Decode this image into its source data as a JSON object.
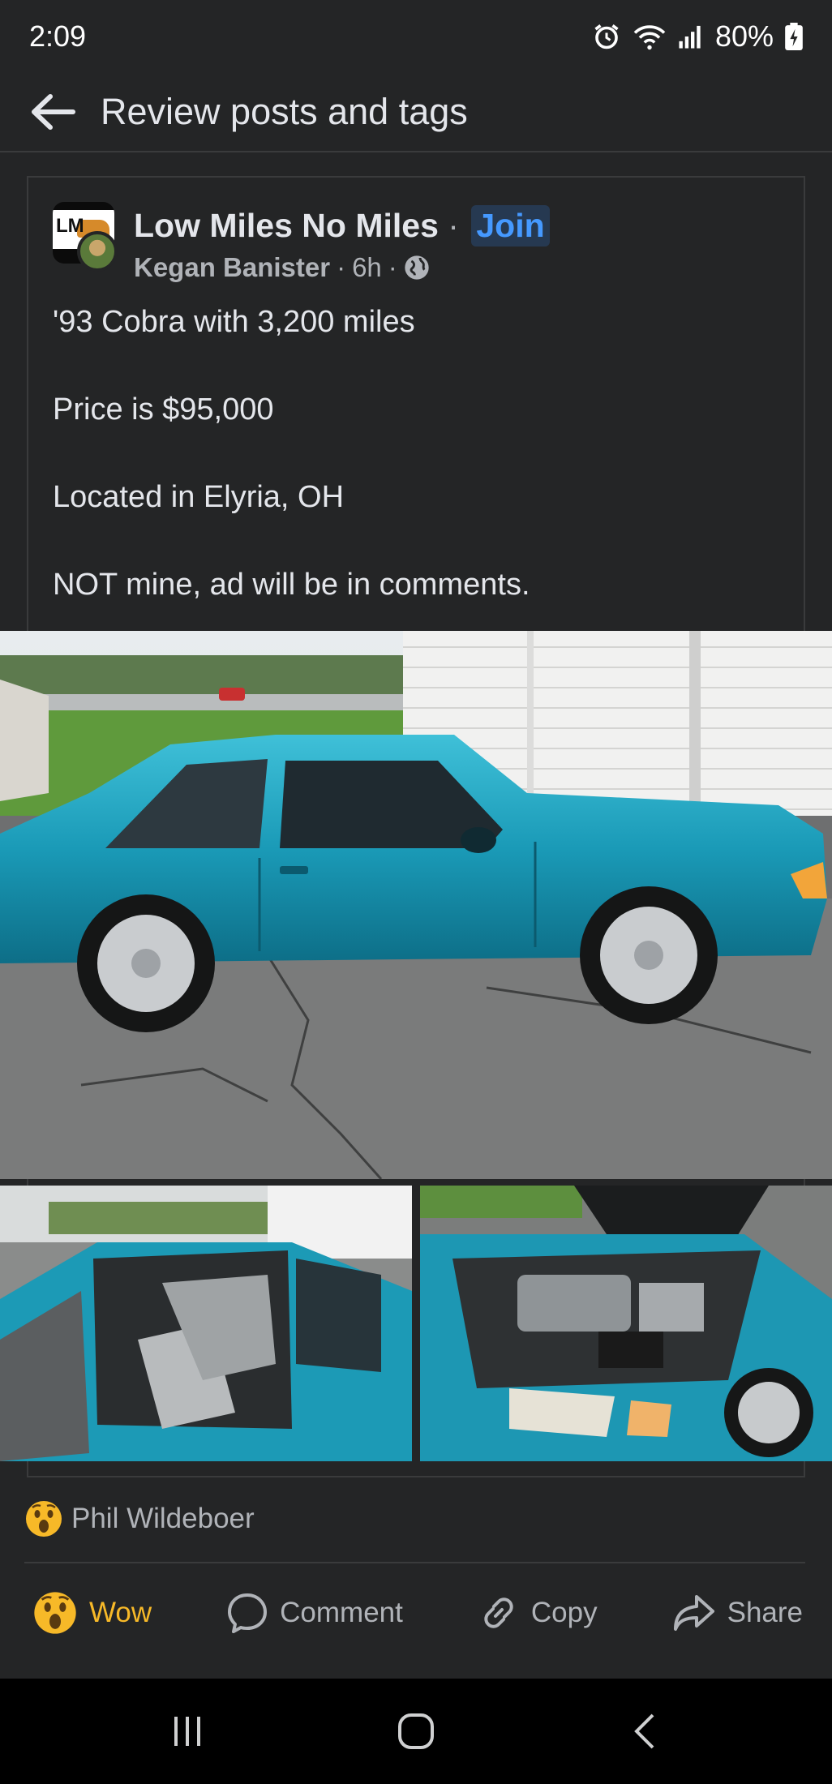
{
  "status_bar": {
    "time": "2:09",
    "battery": "80%",
    "icons": [
      "alarm-icon",
      "wifi-icon",
      "signal-icon",
      "battery-charging-icon"
    ]
  },
  "header": {
    "title": "Review posts and tags",
    "back_icon": "arrow-left-icon"
  },
  "post": {
    "group_name": "Low Miles No Miles",
    "join_label": "Join",
    "author": "Kegan Banister",
    "time": "6h",
    "audience_icon": "globe-icon",
    "group_avatar_text": "LM",
    "text_lines": [
      "'93 Cobra with 3,200 miles",
      "Price is $95,000",
      "Located in Elyria, OH",
      "NOT mine, ad will be in comments."
    ],
    "photos": [
      "car-side-photo",
      "car-interior-photo",
      "car-engine-photo"
    ]
  },
  "reactions": {
    "reactor_name": "Phil Wildeboer",
    "emoji": "wow-emoji-icon"
  },
  "actions": {
    "wow": "Wow",
    "comment": "Comment",
    "copy": "Copy",
    "share": "Share"
  },
  "colors": {
    "background": "#242526",
    "accent_blue": "#4599ff",
    "wow_yellow": "#f7b928",
    "car_teal": "#1f9bb5"
  }
}
